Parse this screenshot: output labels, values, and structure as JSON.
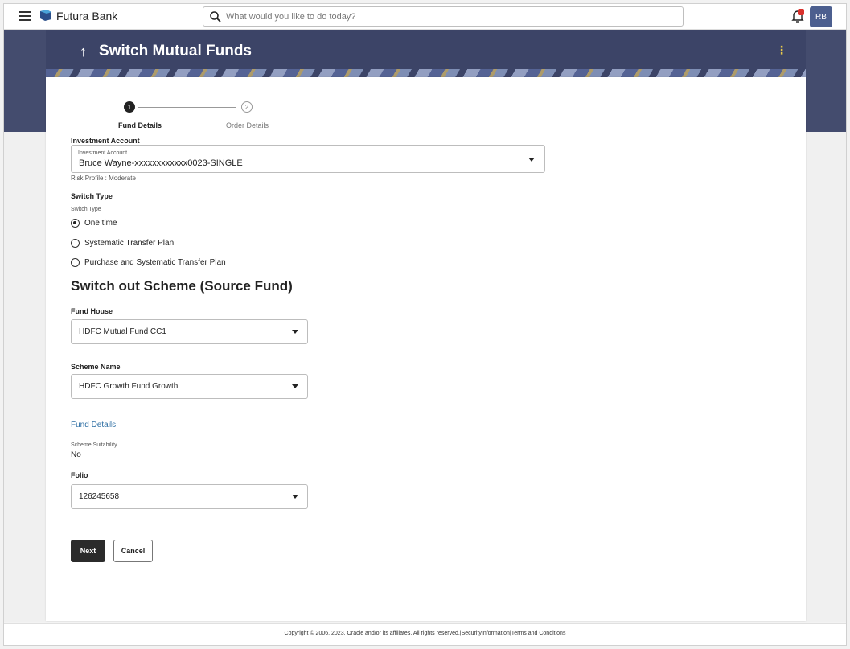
{
  "header": {
    "brand": "Futura Bank",
    "search_placeholder": "What would you like to do today?",
    "avatar_initials": "RB",
    "back_arrow": "↑",
    "page_title": "Switch Mutual Funds",
    "kebab": "⋮"
  },
  "stepper": {
    "step1_number": "1",
    "step1_label": "Fund Details",
    "step2_number": "2",
    "step2_label": "Order Details"
  },
  "investment_account": {
    "section_label": "Investment Account",
    "field_label": "Investment Account",
    "value": "Bruce Wayne-xxxxxxxxxxxx0023-SINGLE",
    "risk_profile": "Risk Profile : Moderate"
  },
  "switch_type": {
    "section_label": "Switch Type",
    "field_label": "Switch Type",
    "options": [
      "One time",
      "Systematic Transfer Plan",
      "Purchase and Systematic Transfer Plan"
    ],
    "selected": "One time"
  },
  "source_fund": {
    "title": "Switch out Scheme (Source Fund)",
    "fund_house_label": "Fund House",
    "fund_house_value": "HDFC Mutual Fund CC1",
    "scheme_name_label": "Scheme Name",
    "scheme_name_value": "HDFC Growth Fund Growth",
    "fund_details_link": "Fund Details",
    "scheme_suitability_label": "Scheme Suitability",
    "scheme_suitability_value": "No",
    "folio_label": "Folio",
    "folio_value": "126245658"
  },
  "actions": {
    "next_label": "Next",
    "cancel_label": "Cancel"
  },
  "footer": {
    "text": "Copyright © 2006, 2023, Oracle and/or its affiliates. All rights reserved.|SecurityInformation|Terms and Conditions"
  },
  "colors": {
    "header_band": "#3c4467",
    "primary_button": "#2b2b2b",
    "link": "#2d6ea3",
    "notification_badge": "#d9312c",
    "avatar": "#4c5f8f"
  },
  "icons": {
    "menu": "hamburger-icon",
    "logo": "bank-logo-icon",
    "search": "search-icon",
    "notifications": "bell-icon"
  }
}
